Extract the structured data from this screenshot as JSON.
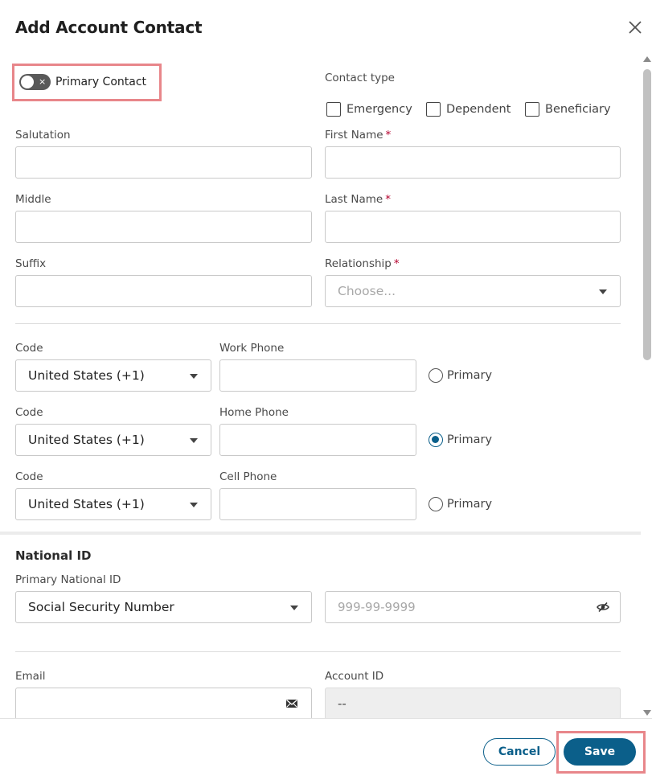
{
  "dialog": {
    "title": "Add Account Contact"
  },
  "primary_contact": {
    "label": "Primary Contact",
    "toggle_off_glyph": "×"
  },
  "contact_type": {
    "label": "Contact type",
    "options": [
      {
        "label": "Emergency",
        "checked": false
      },
      {
        "label": "Dependent",
        "checked": false
      },
      {
        "label": "Beneficiary",
        "checked": false
      }
    ]
  },
  "name_fields": {
    "salutation": {
      "label": "Salutation",
      "value": ""
    },
    "first_name": {
      "label": "First Name",
      "required_mark": "*",
      "value": ""
    },
    "middle": {
      "label": "Middle",
      "value": ""
    },
    "last_name": {
      "label": "Last Name",
      "required_mark": "*",
      "value": ""
    },
    "suffix": {
      "label": "Suffix",
      "value": ""
    },
    "relationship": {
      "label": "Relationship",
      "required_mark": "*",
      "placeholder": "Choose..."
    }
  },
  "phones": [
    {
      "code_label": "Code",
      "code_value": "United States (+1)",
      "phone_label": "Work Phone",
      "phone_value": "",
      "primary_label": "Primary",
      "primary_checked": false
    },
    {
      "code_label": "Code",
      "code_value": "United States (+1)",
      "phone_label": "Home Phone",
      "phone_value": "",
      "primary_label": "Primary",
      "primary_checked": true
    },
    {
      "code_label": "Code",
      "code_value": "United States (+1)",
      "phone_label": "Cell Phone",
      "phone_value": "",
      "primary_label": "Primary",
      "primary_checked": false
    }
  ],
  "national_id": {
    "section_title": "National ID",
    "primary_label": "Primary National ID",
    "type_value": "Social Security Number",
    "number_placeholder": "999-99-9999",
    "visibility_icon": "eye-slash-icon"
  },
  "email": {
    "label": "Email",
    "value": "",
    "icon": "envelope-icon"
  },
  "account_id": {
    "label": "Account ID",
    "value": "--"
  },
  "footer": {
    "cancel_label": "Cancel",
    "save_label": "Save"
  },
  "colors": {
    "primary": "#0b5f8a",
    "highlight": "#e8868a",
    "required": "#b3002d"
  }
}
